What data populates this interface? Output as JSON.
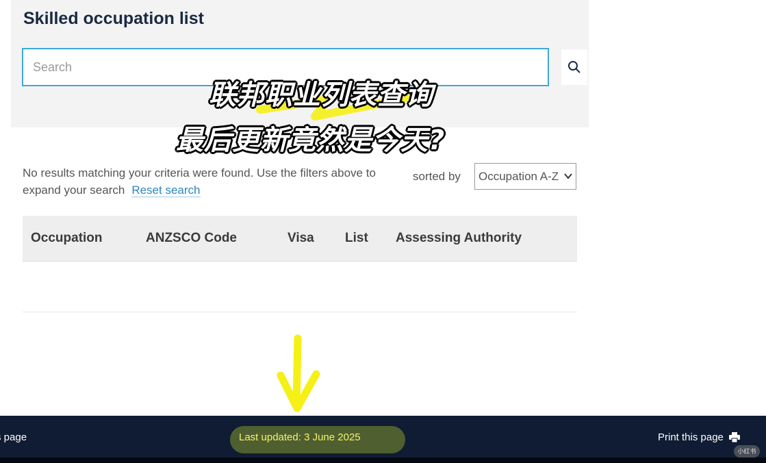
{
  "panel": {
    "title": "Skilled occupation list",
    "search_placeholder": "Search",
    "search_value": ""
  },
  "results": {
    "message": "No results matching your criteria were found. Use the filters above to expand your search",
    "reset_label": "Reset search",
    "sorted_label": "sorted by",
    "sort_value": "Occupation A-Z"
  },
  "table": {
    "headers": [
      "Occupation",
      "ANZSCO Code",
      "Visa",
      "List",
      "Assessing Authority"
    ]
  },
  "overlay": {
    "line1": "联邦职业列表查询",
    "line2": "最后更新竟然是今天?"
  },
  "footer": {
    "left_link": "s page",
    "last_updated": "Last updated: 3 June 2025",
    "print_label": "Print this page"
  },
  "watermark": "小红书",
  "colors": {
    "accent_border": "#3ca8d8",
    "link": "#2a86c2",
    "footer_bg": "#0f1c33",
    "highlight_arrow": "#f5f016"
  }
}
